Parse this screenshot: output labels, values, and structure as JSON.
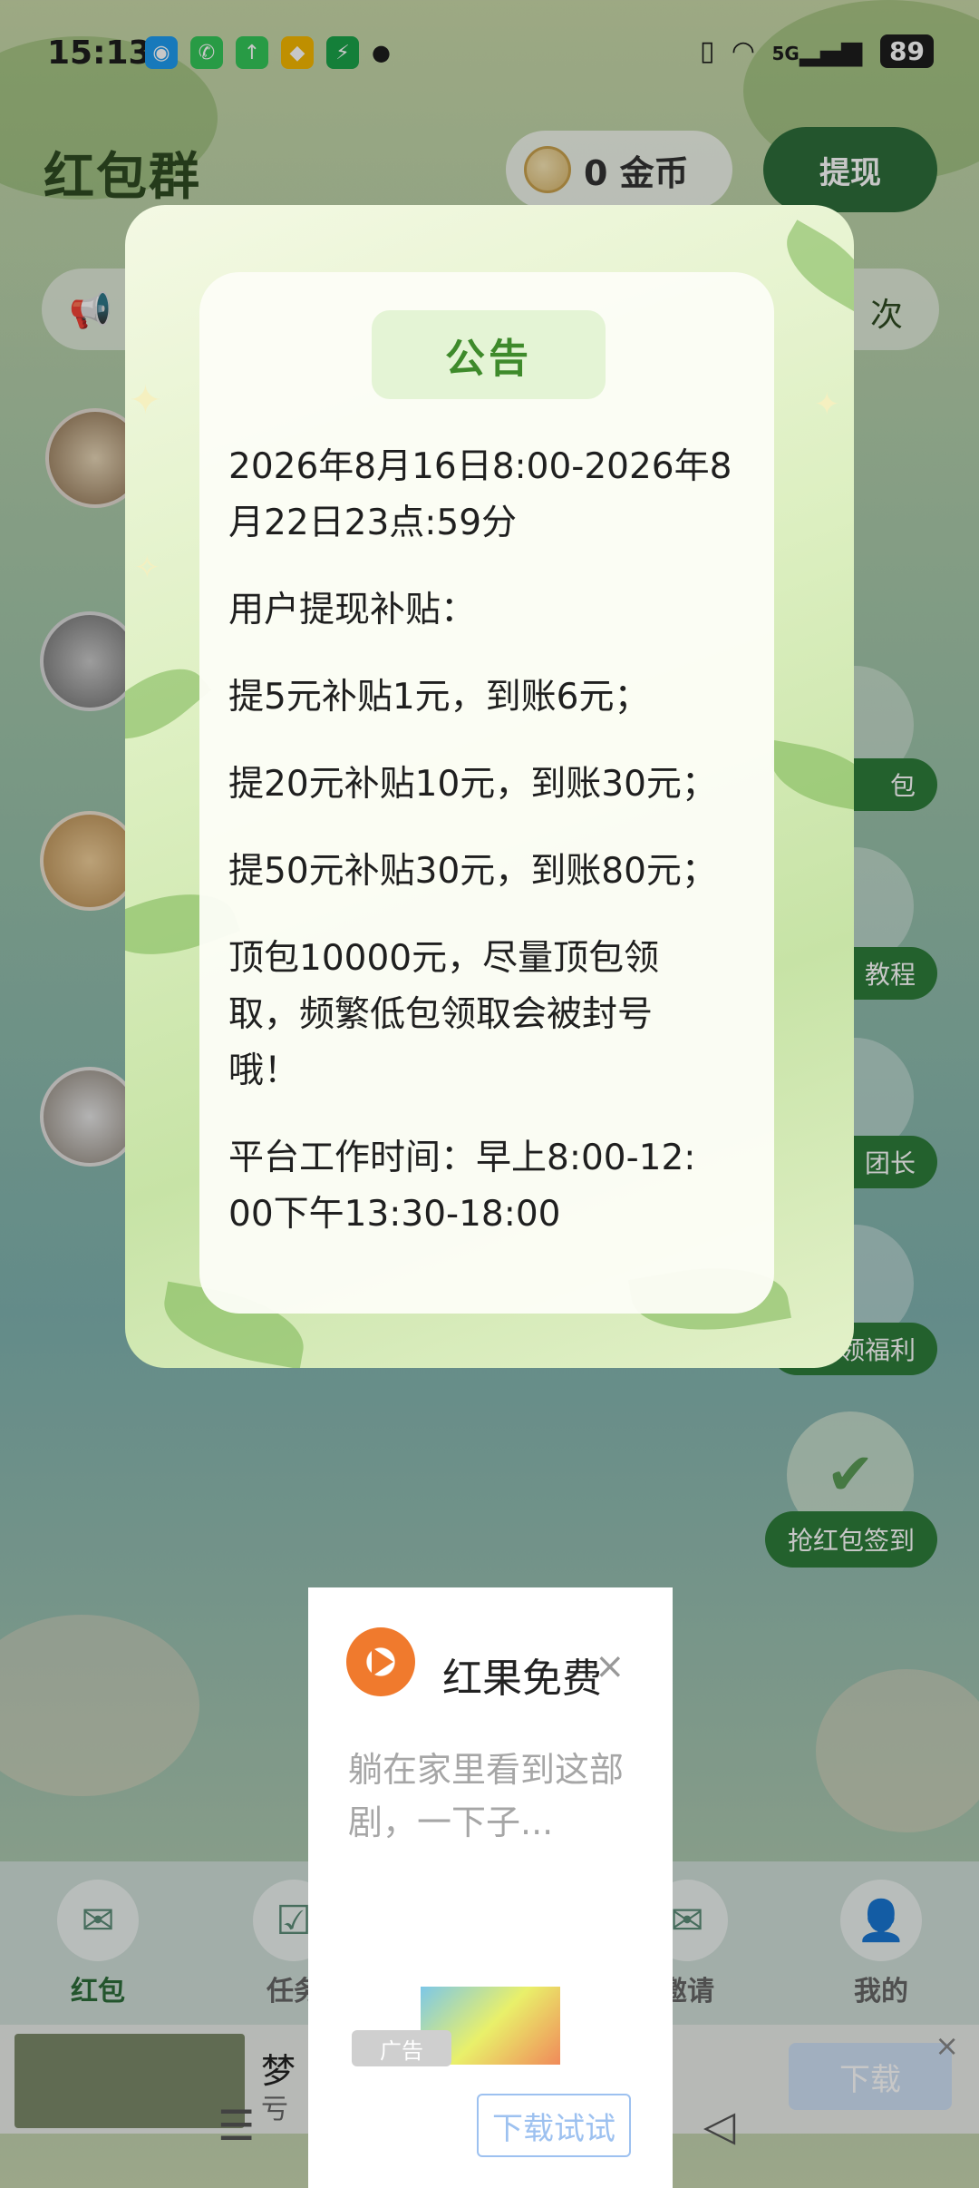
{
  "status_bar": {
    "time": "15:13",
    "network": "5G",
    "battery": "89"
  },
  "header": {
    "title": "红包群",
    "coin_text": "0 金币",
    "withdraw_label": "提现"
  },
  "notice_bar": {
    "right_text": "次"
  },
  "side_buttons": [
    {
      "label": "包"
    },
    {
      "label": "教程"
    },
    {
      "label": "团长"
    },
    {
      "label": "领福利"
    },
    {
      "label": "抢红包签到"
    }
  ],
  "announcement": {
    "header": "公告",
    "paragraphs": [
      "2026年8月16日8:00-2026年8月22日23点:59分",
      "用户提现补贴：",
      "提5元补贴1元，到账6元；",
      "提20元补贴10元，到账30元；",
      "提50元补贴30元，到账80元；",
      "顶包10000元，尽量顶包领取，频繁低包领取会被封号哦！",
      "平台工作时间：早上8:00-12:00下午13:30-18:00"
    ]
  },
  "tabbar": {
    "tabs": [
      {
        "label": "红包",
        "active": true
      },
      {
        "label": "任务",
        "active": false
      },
      {
        "label": "邀请",
        "active": false
      },
      {
        "label": "我的",
        "active": false
      }
    ]
  },
  "ad_strip": {
    "title": "梦",
    "subtitle": "亏",
    "button": "下载",
    "close": "×"
  },
  "ad_popup": {
    "title": "红果免费",
    "description": "躺在家里看到这部剧，一下子...",
    "tag": "广告",
    "button": "下载试试",
    "close": "×"
  },
  "colors": {
    "accent_green": "#2e7d3a",
    "header_green": "#3e8a2b"
  }
}
